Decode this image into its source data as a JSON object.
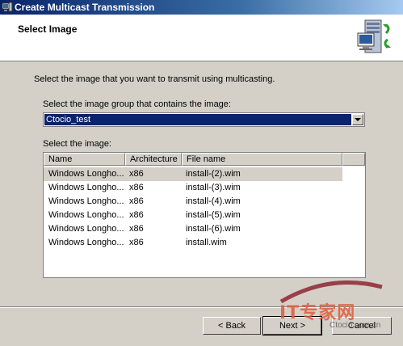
{
  "window": {
    "title": "Create Multicast Transmission"
  },
  "header": {
    "title": "Select Image"
  },
  "instructions": "Select the image that you want to transmit using multicasting.",
  "group_label": "Select the image group that contains the image:",
  "group_select": {
    "selected": "Ctocio_test"
  },
  "image_label": "Select the image:",
  "list": {
    "columns": [
      "Name",
      "Architecture",
      "File name"
    ],
    "rows": [
      {
        "name": "Windows Longho...",
        "arch": "x86",
        "file": "install-(2).wim",
        "selected": true
      },
      {
        "name": "Windows Longho...",
        "arch": "x86",
        "file": "install-(3).wim",
        "selected": false
      },
      {
        "name": "Windows Longho...",
        "arch": "x86",
        "file": "install-(4).wim",
        "selected": false
      },
      {
        "name": "Windows Longho...",
        "arch": "x86",
        "file": "install-(5).wim",
        "selected": false
      },
      {
        "name": "Windows Longho...",
        "arch": "x86",
        "file": "install-(6).wim",
        "selected": false
      },
      {
        "name": "Windows Longho...",
        "arch": "x86",
        "file": "install.wim",
        "selected": false
      }
    ]
  },
  "buttons": {
    "back": "< Back",
    "next": "Next >",
    "cancel": "Cancel"
  },
  "watermark": {
    "text": "IT专家网",
    "sub": "Ctocio.com.cn"
  },
  "icons": {
    "app": "server-icon",
    "wizard": "server-monitor-icon",
    "dropdown": "chevron-down-icon"
  },
  "colors": {
    "selection": "#0a246a",
    "titlebar": "#0a246a",
    "dialog": "#d4d0c8"
  }
}
